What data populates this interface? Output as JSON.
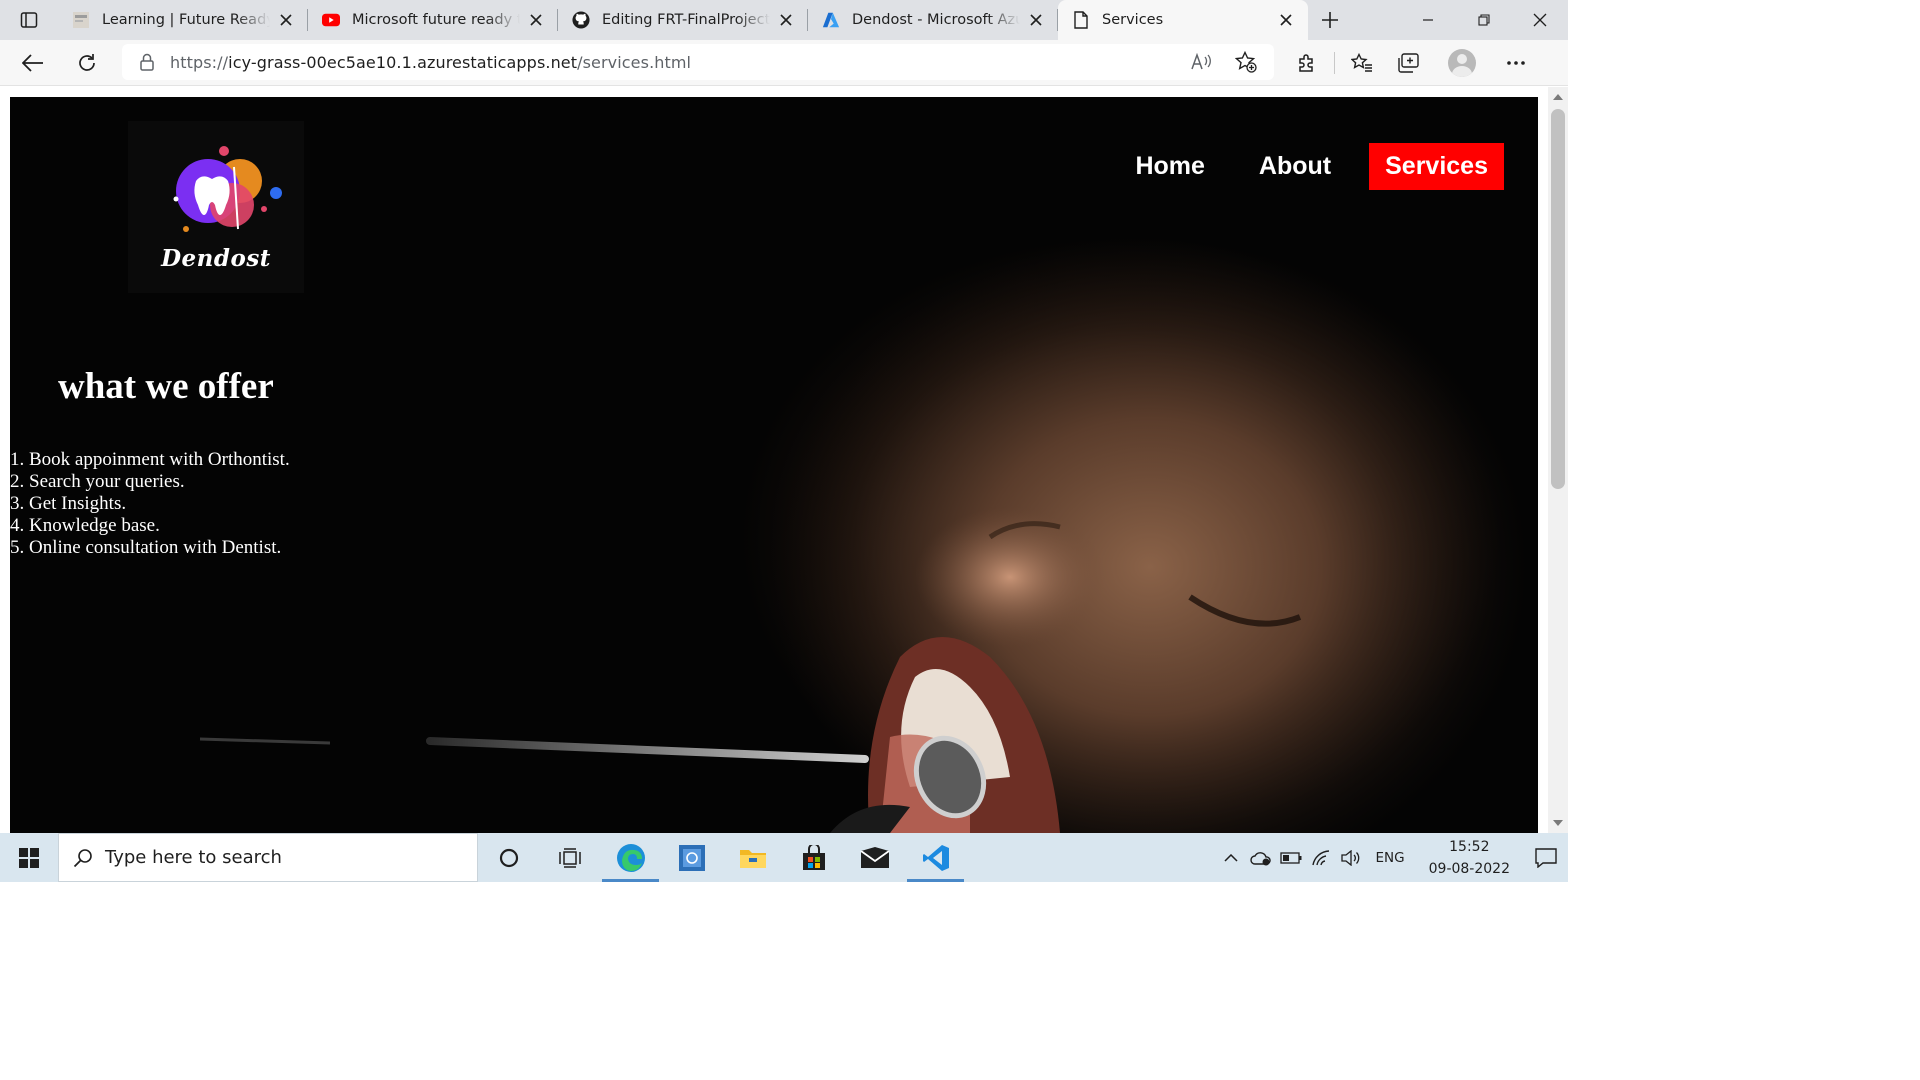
{
  "browser": {
    "tabs": [
      {
        "title": "Learning | Future Ready Ta",
        "icon": "learning-favicon-icon",
        "active": false
      },
      {
        "title": "Microsoft future ready tale",
        "icon": "youtube-icon",
        "active": false
      },
      {
        "title": "Editing FRT-FinalProject/R",
        "icon": "github-icon",
        "active": false
      },
      {
        "title": "Dendost - Microsoft Azure",
        "icon": "azure-icon",
        "active": false
      },
      {
        "title": "Services",
        "icon": "page-icon",
        "active": true
      }
    ],
    "url_prefix": "https://",
    "url_host": "icy-grass-00ec5ae10.1.azurestaticapps.net",
    "url_path": "/services.html"
  },
  "site": {
    "logo_text": "Dendost",
    "nav": [
      {
        "label": "Home",
        "active": false
      },
      {
        "label": "About",
        "active": false
      },
      {
        "label": "Services",
        "active": true
      }
    ],
    "headline": "what we offer",
    "offers": [
      "1. Book appoinment with Orthontist.",
      "2. Search your queries.",
      "3. Get Insights.",
      "4. Knowledge base.",
      "5. Online consultation with Dentist."
    ]
  },
  "taskbar": {
    "search_placeholder": "Type here to search",
    "language": "ENG",
    "time": "15:52",
    "date": "09-08-2022"
  },
  "colors": {
    "accent_red": "#ff0000",
    "taskbar_bg": "#d9e6ef",
    "tabstrip_bg": "#dfe1e5"
  }
}
